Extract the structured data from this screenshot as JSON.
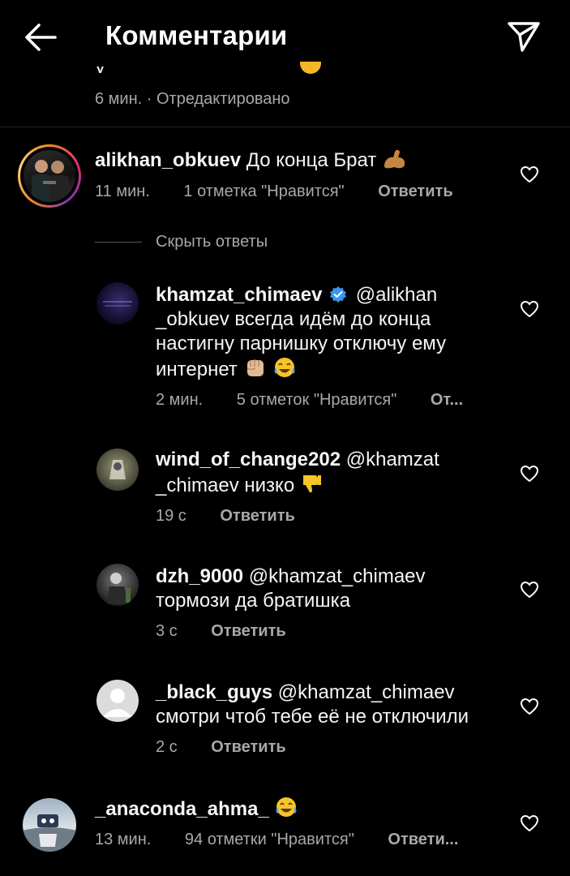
{
  "header": {
    "title": "Комментарии",
    "back_icon": "arrow-left-icon",
    "share_icon": "paper-plane-icon"
  },
  "partial_comment": {
    "text_fragment": "у                          ",
    "meta": "6 мин. · Отредактировано"
  },
  "comments": [
    {
      "username": "alikhan_obkuev",
      "text": "До конца Брат",
      "time": "11 мин.",
      "likes": "1 отметка \"Нравится\"",
      "reply": "Ответить",
      "has_story_ring": true
    },
    {
      "username": "_anaconda_ahma_",
      "text": "",
      "time": "13 мин.",
      "likes": "94 отметки \"Нравится\"",
      "reply": "Ответи..."
    }
  ],
  "hide_replies": "Скрыть ответы",
  "replies": [
    {
      "username": "khamzat_chimaev",
      "verified": true,
      "mention": "@alikhan",
      "line2": "_obkuev всегда идём  до конца",
      "line3": "настигну парнишку отключу ему",
      "line4": "интернет",
      "time": "2 мин.",
      "likes": "5 отметок \"Нравится\"",
      "reply": "От..."
    },
    {
      "username": "wind_of_change202",
      "mention": "@khamzat",
      "line2": "_chimaev низко",
      "time": "19 с",
      "reply": "Ответить"
    },
    {
      "username": "dzh_9000",
      "mention": "@khamzat_chimaev",
      "line2": "тормози да братишка",
      "time": "3 с",
      "reply": "Ответить"
    },
    {
      "username": "_black_guys",
      "mention": "@khamzat_chimaev",
      "line2": "смотри чтоб тебе её не отключили",
      "time": "2 с",
      "reply": "Ответить"
    }
  ],
  "colors": {
    "background": "#000000",
    "text": "#f5f5f5",
    "secondary": "#a8a8a8",
    "verified": "#3897f0"
  }
}
